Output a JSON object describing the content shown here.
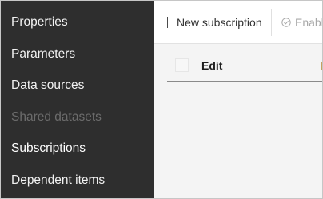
{
  "sidebar": {
    "items": [
      {
        "label": "Properties",
        "state": "normal"
      },
      {
        "label": "Parameters",
        "state": "normal"
      },
      {
        "label": "Data sources",
        "state": "normal"
      },
      {
        "label": "Shared datasets",
        "state": "disabled"
      },
      {
        "label": "Subscriptions",
        "state": "active"
      },
      {
        "label": "Dependent items",
        "state": "normal"
      }
    ]
  },
  "toolbar": {
    "new_subscription_label": "New subscription",
    "enable_label": "Enable",
    "new_icon": "plus-icon",
    "enable_icon": "check-circle-icon"
  },
  "table": {
    "columns": [
      "Edit"
    ]
  },
  "colors": {
    "sidebar_bg": "#2e2e2e",
    "sidebar_text": "#f2f2f2",
    "sidebar_disabled_text": "#6c6c6c",
    "content_bg": "#f4f4f4"
  }
}
